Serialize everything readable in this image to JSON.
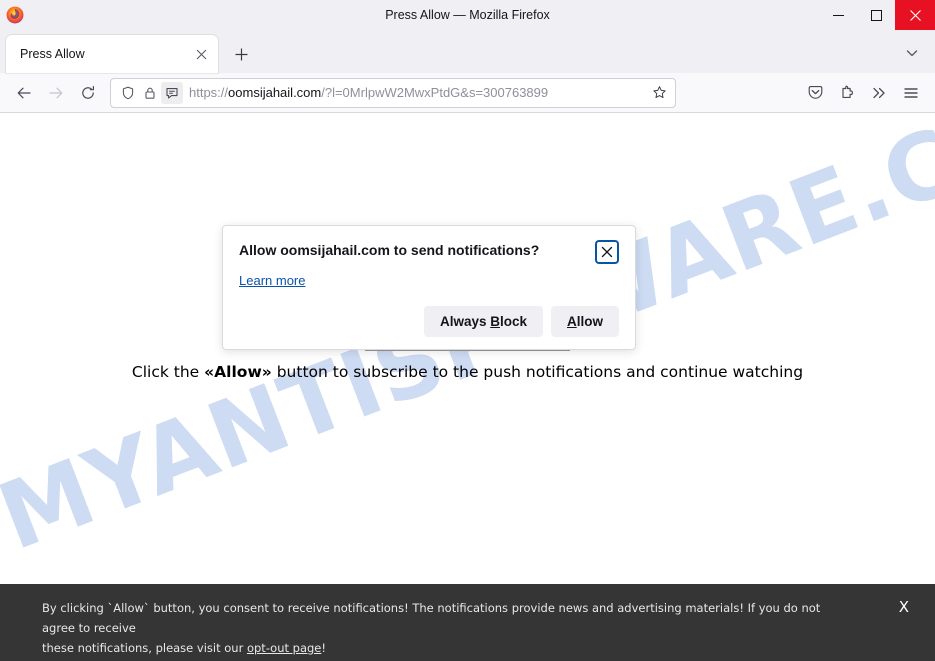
{
  "window": {
    "title": "Press Allow — Mozilla Firefox",
    "minimize_label": "Minimize",
    "maximize_label": "Maximize",
    "close_label": "Close",
    "close_bg": "#e81123"
  },
  "tabs": {
    "items": [
      {
        "label": "Press Allow",
        "close_label": "Close tab"
      }
    ],
    "new_tab_label": "Open a new tab",
    "list_all_label": "List all tabs"
  },
  "toolbar": {
    "back_label": "Go back one page",
    "forward_label": "Go forward one page",
    "reload_label": "Reload current page",
    "pocket_label": "Save to Pocket",
    "extensions_label": "Extensions",
    "overflow_label": "More tools",
    "menu_label": "Open application menu"
  },
  "urlbar": {
    "scheme": "https://",
    "host": "oomsijahail.com",
    "path": "/?l=0MrlpwW2MwxPtdG&s=300763899",
    "full_url": "https://oomsijahail.com/?l=0MrlpwW2MwxPtdG&s=300763899",
    "shield_label": "Tracking protection",
    "lock_label": "Connection secure",
    "permission_label": "Notification permission requested",
    "bookmark_label": "Bookmark this page"
  },
  "doorhanger": {
    "title": "Allow oomsijahail.com to send notifications?",
    "learn_more": "Learn more",
    "close_label": "Close",
    "buttons": {
      "block_prefix": "Always ",
      "block_accesskey": "B",
      "block_suffix": "lock",
      "allow_accesskey": "A",
      "allow_suffix": "llow"
    },
    "focus_ring_color": "#0a54a4"
  },
  "page": {
    "watermark": "MYANTISPYWARE.COM",
    "watermark_color": "#c9d9f2",
    "message_prefix": "Click the ",
    "message_highlight": "«Allow»",
    "message_suffix": " button to subscribe to the push notifications and continue watching",
    "progress_label": "Loading"
  },
  "consent": {
    "line1": "By clicking `Allow` button, you consent to receive notifications! The notifications provide news and advertising materials! If you do not agree to receive",
    "line2_prefix": "these notifications, please visit our ",
    "link": "opt-out page",
    "line2_suffix": "!",
    "close_label": "X",
    "background": "#353535"
  }
}
